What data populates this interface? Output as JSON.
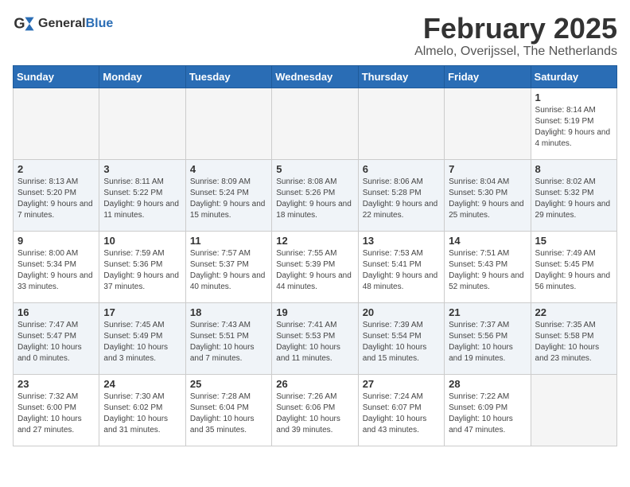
{
  "logo": {
    "text_general": "General",
    "text_blue": "Blue"
  },
  "title": {
    "month_year": "February 2025",
    "location": "Almelo, Overijssel, The Netherlands"
  },
  "headers": [
    "Sunday",
    "Monday",
    "Tuesday",
    "Wednesday",
    "Thursday",
    "Friday",
    "Saturday"
  ],
  "weeks": [
    [
      {
        "day": "",
        "info": ""
      },
      {
        "day": "",
        "info": ""
      },
      {
        "day": "",
        "info": ""
      },
      {
        "day": "",
        "info": ""
      },
      {
        "day": "",
        "info": ""
      },
      {
        "day": "",
        "info": ""
      },
      {
        "day": "1",
        "info": "Sunrise: 8:14 AM\nSunset: 5:19 PM\nDaylight: 9 hours and 4 minutes."
      }
    ],
    [
      {
        "day": "2",
        "info": "Sunrise: 8:13 AM\nSunset: 5:20 PM\nDaylight: 9 hours and 7 minutes."
      },
      {
        "day": "3",
        "info": "Sunrise: 8:11 AM\nSunset: 5:22 PM\nDaylight: 9 hours and 11 minutes."
      },
      {
        "day": "4",
        "info": "Sunrise: 8:09 AM\nSunset: 5:24 PM\nDaylight: 9 hours and 15 minutes."
      },
      {
        "day": "5",
        "info": "Sunrise: 8:08 AM\nSunset: 5:26 PM\nDaylight: 9 hours and 18 minutes."
      },
      {
        "day": "6",
        "info": "Sunrise: 8:06 AM\nSunset: 5:28 PM\nDaylight: 9 hours and 22 minutes."
      },
      {
        "day": "7",
        "info": "Sunrise: 8:04 AM\nSunset: 5:30 PM\nDaylight: 9 hours and 25 minutes."
      },
      {
        "day": "8",
        "info": "Sunrise: 8:02 AM\nSunset: 5:32 PM\nDaylight: 9 hours and 29 minutes."
      }
    ],
    [
      {
        "day": "9",
        "info": "Sunrise: 8:00 AM\nSunset: 5:34 PM\nDaylight: 9 hours and 33 minutes."
      },
      {
        "day": "10",
        "info": "Sunrise: 7:59 AM\nSunset: 5:36 PM\nDaylight: 9 hours and 37 minutes."
      },
      {
        "day": "11",
        "info": "Sunrise: 7:57 AM\nSunset: 5:37 PM\nDaylight: 9 hours and 40 minutes."
      },
      {
        "day": "12",
        "info": "Sunrise: 7:55 AM\nSunset: 5:39 PM\nDaylight: 9 hours and 44 minutes."
      },
      {
        "day": "13",
        "info": "Sunrise: 7:53 AM\nSunset: 5:41 PM\nDaylight: 9 hours and 48 minutes."
      },
      {
        "day": "14",
        "info": "Sunrise: 7:51 AM\nSunset: 5:43 PM\nDaylight: 9 hours and 52 minutes."
      },
      {
        "day": "15",
        "info": "Sunrise: 7:49 AM\nSunset: 5:45 PM\nDaylight: 9 hours and 56 minutes."
      }
    ],
    [
      {
        "day": "16",
        "info": "Sunrise: 7:47 AM\nSunset: 5:47 PM\nDaylight: 10 hours and 0 minutes."
      },
      {
        "day": "17",
        "info": "Sunrise: 7:45 AM\nSunset: 5:49 PM\nDaylight: 10 hours and 3 minutes."
      },
      {
        "day": "18",
        "info": "Sunrise: 7:43 AM\nSunset: 5:51 PM\nDaylight: 10 hours and 7 minutes."
      },
      {
        "day": "19",
        "info": "Sunrise: 7:41 AM\nSunset: 5:53 PM\nDaylight: 10 hours and 11 minutes."
      },
      {
        "day": "20",
        "info": "Sunrise: 7:39 AM\nSunset: 5:54 PM\nDaylight: 10 hours and 15 minutes."
      },
      {
        "day": "21",
        "info": "Sunrise: 7:37 AM\nSunset: 5:56 PM\nDaylight: 10 hours and 19 minutes."
      },
      {
        "day": "22",
        "info": "Sunrise: 7:35 AM\nSunset: 5:58 PM\nDaylight: 10 hours and 23 minutes."
      }
    ],
    [
      {
        "day": "23",
        "info": "Sunrise: 7:32 AM\nSunset: 6:00 PM\nDaylight: 10 hours and 27 minutes."
      },
      {
        "day": "24",
        "info": "Sunrise: 7:30 AM\nSunset: 6:02 PM\nDaylight: 10 hours and 31 minutes."
      },
      {
        "day": "25",
        "info": "Sunrise: 7:28 AM\nSunset: 6:04 PM\nDaylight: 10 hours and 35 minutes."
      },
      {
        "day": "26",
        "info": "Sunrise: 7:26 AM\nSunset: 6:06 PM\nDaylight: 10 hours and 39 minutes."
      },
      {
        "day": "27",
        "info": "Sunrise: 7:24 AM\nSunset: 6:07 PM\nDaylight: 10 hours and 43 minutes."
      },
      {
        "day": "28",
        "info": "Sunrise: 7:22 AM\nSunset: 6:09 PM\nDaylight: 10 hours and 47 minutes."
      },
      {
        "day": "",
        "info": ""
      }
    ]
  ]
}
